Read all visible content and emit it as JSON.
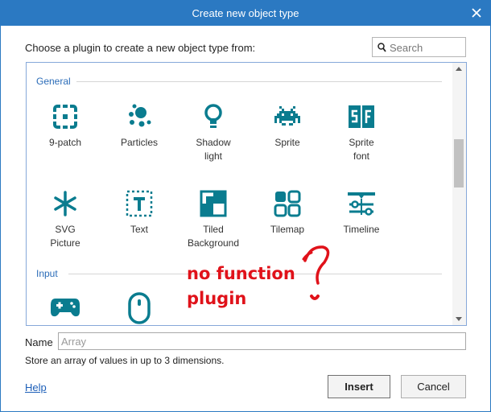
{
  "window": {
    "title": "Create new object type"
  },
  "prompt": "Choose a plugin to create a new object type from:",
  "search": {
    "placeholder": "Search",
    "value": ""
  },
  "categories": [
    {
      "label": "General"
    },
    {
      "label": "Input"
    }
  ],
  "general_items": [
    {
      "label": "9-patch",
      "icon": "9-patch-icon"
    },
    {
      "label": "Particles",
      "icon": "particles-icon"
    },
    {
      "label": "Shadow\nlight",
      "icon": "lightbulb-icon"
    },
    {
      "label": "Sprite",
      "icon": "space-invader-icon"
    },
    {
      "label": "Sprite\nfont",
      "icon": "sprite-font-icon"
    },
    {
      "label": "SVG\nPicture",
      "icon": "asterisk-icon"
    },
    {
      "label": "Text",
      "icon": "text-box-icon"
    },
    {
      "label": "Tiled\nBackground",
      "icon": "tiled-background-icon"
    },
    {
      "label": "Tilemap",
      "icon": "tilemap-icon"
    },
    {
      "label": "Timeline",
      "icon": "timeline-icon"
    }
  ],
  "input_items": [
    {
      "icon": "gamepad-icon"
    },
    {
      "icon": "mouse-icon"
    }
  ],
  "annotation": {
    "line1": "no function",
    "line2": "plugin"
  },
  "name": {
    "label": "Name",
    "placeholder": "Array",
    "value": ""
  },
  "description": "Store an array of values in up to 3 dimensions.",
  "footer": {
    "help": "Help",
    "insert": "Insert",
    "cancel": "Cancel"
  },
  "colors": {
    "titlebar": "#2b79c2",
    "icon": "#0a7c8f",
    "category": "#2b6cb8",
    "annotation": "#e0121a"
  }
}
